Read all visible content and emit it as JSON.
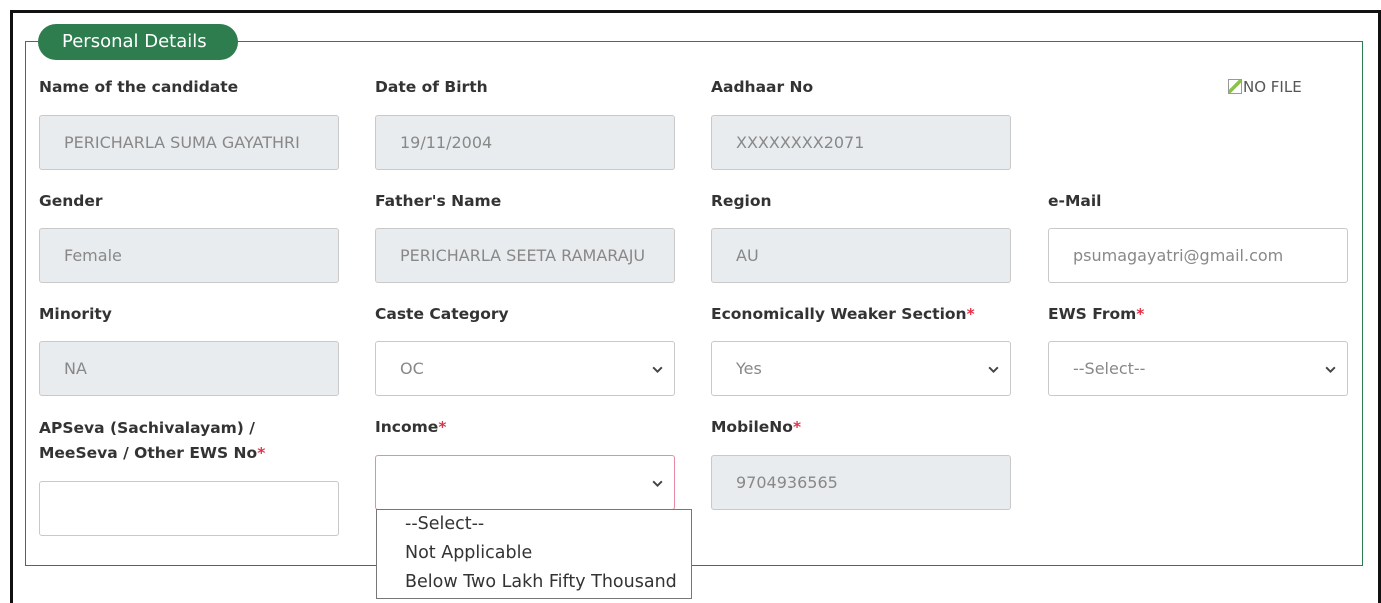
{
  "section_title": "Personal Details",
  "photo_alt": "NO FILE",
  "fields": {
    "candidate_name": {
      "label": "Name of the candidate",
      "value": "PERICHARLA SUMA GAYATHRI"
    },
    "dob": {
      "label": "Date of Birth",
      "value": "19/11/2004"
    },
    "aadhaar": {
      "label": "Aadhaar No",
      "value": "XXXXXXXX2071"
    },
    "gender": {
      "label": "Gender",
      "value": "Female"
    },
    "father_name": {
      "label": "Father's Name",
      "value": "PERICHARLA SEETA RAMARAJU"
    },
    "region": {
      "label": "Region",
      "value": "AU"
    },
    "email": {
      "label": "e-Mail",
      "value": "psumagayatri@gmail.com"
    },
    "minority": {
      "label": "Minority",
      "value": "NA"
    },
    "caste": {
      "label": "Caste Category",
      "value": "OC"
    },
    "ews": {
      "label": "Economically Weaker Section",
      "value": "Yes"
    },
    "ews_from": {
      "label": "EWS From",
      "value": "--Select--"
    },
    "ews_no": {
      "label": "APSeva (Sachivalayam) / MeeSeva / Other EWS No",
      "value": ""
    },
    "income": {
      "label": "Income",
      "value": ""
    },
    "mobile": {
      "label": "MobileNo",
      "value": "9704936565"
    }
  },
  "required_mark": "*",
  "income_options": [
    "--Select--",
    "Not Applicable",
    "Below Two Lakh Fifty Thousand"
  ],
  "colors": {
    "accent": "#2e7d4f",
    "required": "#e0334a",
    "readonly_bg": "#e9ecef",
    "focus_border": "#e98ca3"
  }
}
